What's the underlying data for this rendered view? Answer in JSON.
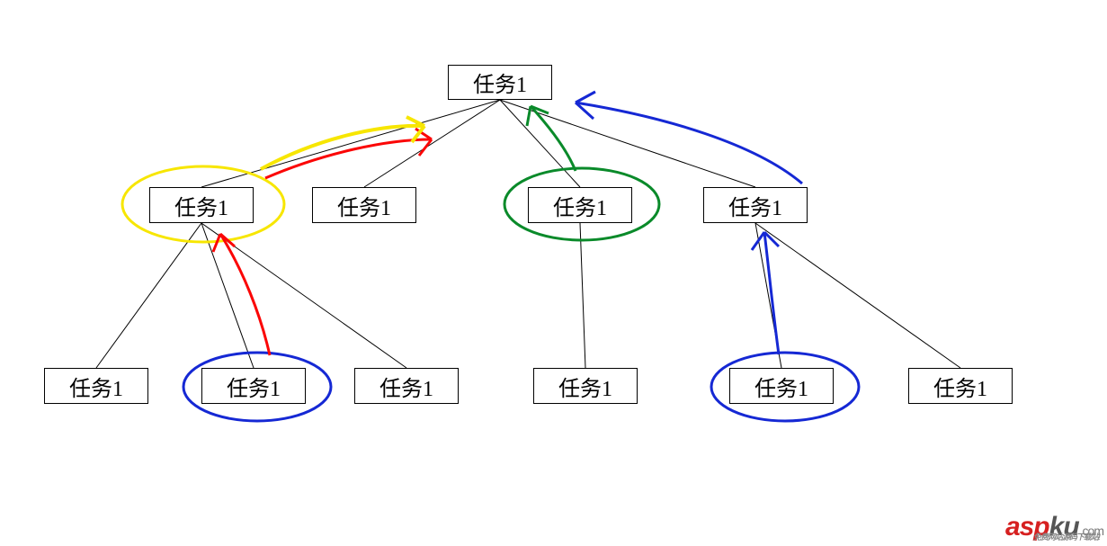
{
  "nodes": {
    "root": {
      "label": "任务1"
    },
    "l2a": {
      "label": "任务1"
    },
    "l2b": {
      "label": "任务1"
    },
    "l2c": {
      "label": "任务1"
    },
    "l2d": {
      "label": "任务1"
    },
    "l3a": {
      "label": "任务1"
    },
    "l3b": {
      "label": "任务1"
    },
    "l3c": {
      "label": "任务1"
    },
    "l3d": {
      "label": "任务1"
    },
    "l3e": {
      "label": "任务1"
    },
    "l3f": {
      "label": "任务1"
    }
  },
  "watermark": {
    "brand_prefix": "asp",
    "brand_suffix": "ku",
    "tld": ".com",
    "subtitle": "免费网站源码下载站!"
  },
  "annotations": {
    "circles": [
      {
        "target": "l2a",
        "color": "yellow"
      },
      {
        "target": "l2c",
        "color": "green"
      },
      {
        "target": "l3b",
        "color": "blue"
      },
      {
        "target": "l3e",
        "color": "blue"
      }
    ],
    "arrows": [
      {
        "from": "l3b",
        "to": "l2a",
        "color": "red"
      },
      {
        "from": "l2a",
        "to": "root",
        "color": "red"
      },
      {
        "from": "l2a",
        "to": "root",
        "color": "yellow"
      },
      {
        "from": "l2c",
        "to": "root",
        "color": "green"
      },
      {
        "from": "l3e",
        "to": "l2d",
        "color": "blue"
      },
      {
        "from": "l2d",
        "to": "root",
        "color": "blue"
      }
    ]
  },
  "colors": {
    "red": "#fb0606",
    "yellow": "#f7e600",
    "green": "#0a8a2a",
    "blue": "#1528d4"
  }
}
